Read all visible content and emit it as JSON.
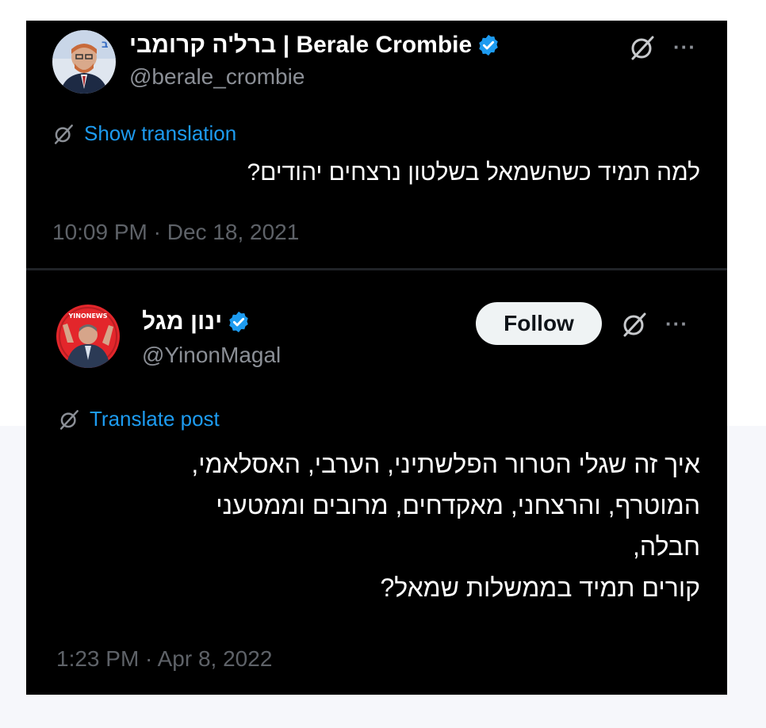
{
  "tweets": [
    {
      "display_name": "ברל'ה קרומבי | Berale Crombie",
      "handle": "@berale_crombie",
      "translate_label": "Show translation",
      "text": "למה תמיד כשהשמאל בשלטון נרצחים יהודים?",
      "timestamp": "10:09 PM · Dec 18, 2021",
      "more": "···"
    },
    {
      "display_name": "ינון מגל",
      "handle": "@YinonMagal",
      "follow_label": "Follow",
      "avatar_badge": "YINONEWS",
      "translate_label": "Translate post",
      "text": "איך זה שגלי הטרור הפלשתיני, הערבי, האסלאמי,\nהמוטרף, והרצחני, מאקדחים, מרובים וממטעני\nחבלה,\nקורים תמיד בממשלות שמאל?",
      "timestamp": "1:23 PM · Apr 8, 2022",
      "more": "···"
    }
  ],
  "colors": {
    "background": "#000000",
    "link": "#1d9bf0",
    "verified": "#1d9bf0",
    "secondary_text": "#8b8f96"
  },
  "icons": [
    "verified-badge-icon",
    "grok-icon",
    "more-icon"
  ]
}
